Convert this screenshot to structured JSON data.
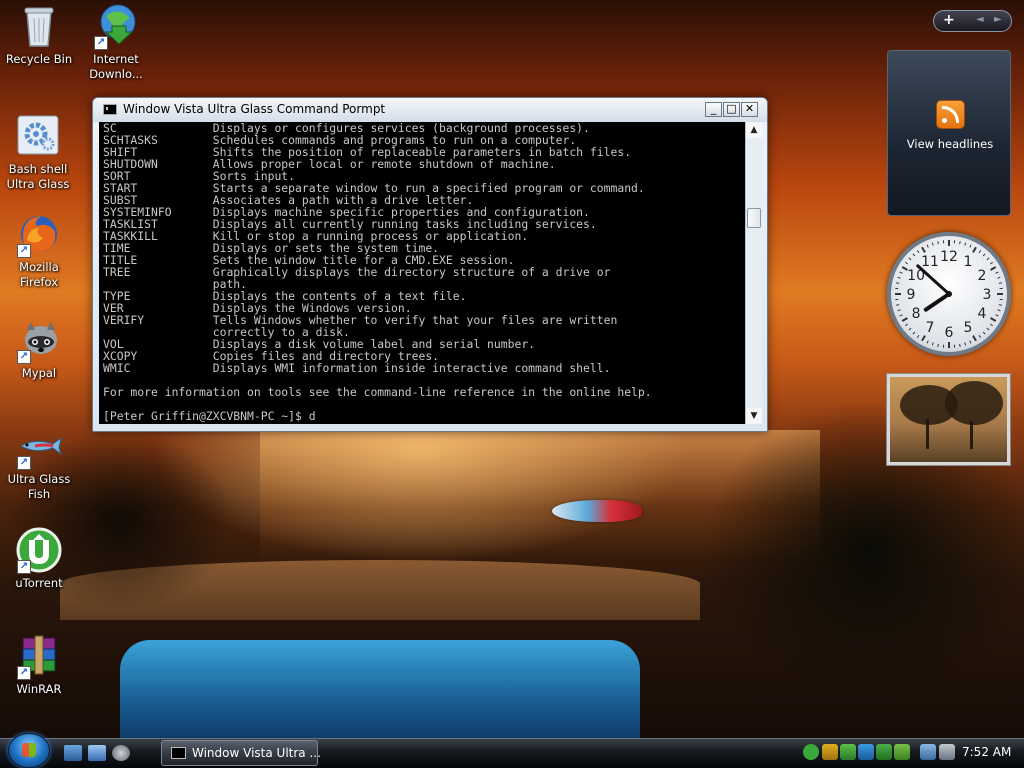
{
  "desktop": {
    "icons": [
      {
        "label": "Recycle Bin"
      },
      {
        "label": "Internet Downlo..."
      },
      {
        "label": "Bash shell Ultra Glass"
      },
      {
        "label": "Mozilla Firefox"
      },
      {
        "label": "Mypal"
      },
      {
        "label": "Ultra Glass Fish"
      },
      {
        "label": "uTorrent"
      },
      {
        "label": "WinRAR"
      }
    ]
  },
  "cmd_window": {
    "title": "Window Vista Ultra Glass Command Pormpt",
    "min_glyph": "_",
    "max_glyph": "□",
    "close_glyph": "✕",
    "lines": [
      "SC              Displays or configures services (background processes).",
      "SCHTASKS        Schedules commands and programs to run on a computer.",
      "SHIFT           Shifts the position of replaceable parameters in batch files.",
      "SHUTDOWN        Allows proper local or remote shutdown of machine.",
      "SORT            Sorts input.",
      "START           Starts a separate window to run a specified program or command.",
      "SUBST           Associates a path with a drive letter.",
      "SYSTEMINFO      Displays machine specific properties and configuration.",
      "TASKLIST        Displays all currently running tasks including services.",
      "TASKKILL        Kill or stop a running process or application.",
      "TIME            Displays or sets the system time.",
      "TITLE           Sets the window title for a CMD.EXE session.",
      "TREE            Graphically displays the directory structure of a drive or",
      "                path.",
      "TYPE            Displays the contents of a text file.",
      "VER             Displays the Windows version.",
      "VERIFY          Tells Windows whether to verify that your files are written",
      "                correctly to a disk.",
      "VOL             Displays a disk volume label and serial number.",
      "XCOPY           Copies files and directory trees.",
      "WMIC            Displays WMI information inside interactive command shell.",
      "",
      "For more information on tools see the command-line reference in the online help.",
      "",
      "[Peter Griffin@ZXCVBNM-PC ~]$ d"
    ],
    "scroll_up": "▲",
    "scroll_down": "▼"
  },
  "sidebar": {
    "add_glyph": "+",
    "prev_glyph": "◄",
    "next_glyph": "►",
    "feed_label": "View headlines",
    "clock": {
      "hour": 7,
      "minute": 52,
      "numerals": [
        "12",
        "1",
        "2",
        "3",
        "4",
        "5",
        "6",
        "7",
        "8",
        "9",
        "10",
        "11"
      ]
    }
  },
  "taskbar": {
    "task_label": "Window Vista Ultra ...",
    "clock": "7:52 AM",
    "colors": {
      "accent": "#1b6fbf"
    }
  }
}
